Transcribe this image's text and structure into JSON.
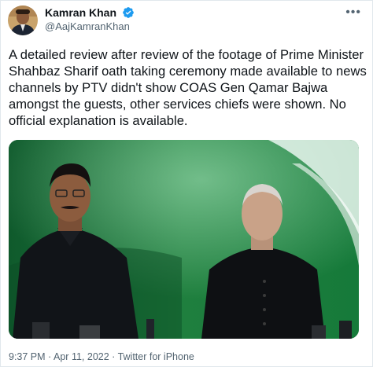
{
  "author": {
    "name": "Kamran Khan",
    "handle": "@AajKamranKhan",
    "verified": true,
    "avatar": "avatar-photo"
  },
  "tweet": {
    "text": "A detailed review after review of the footage of Prime Minister Shahbaz Sharif oath taking ceremony made available to news channels by PTV didn't show COAS Gen Qamar Bajwa amongst the guests, other services chiefs were shown. No official explanation is available.",
    "media": "photo-two-men-at-oath-ceremony"
  },
  "meta": {
    "time": "9:37 PM",
    "separator": "·",
    "date": "Apr 11, 2022",
    "source": "Twitter for iPhone"
  },
  "colors": {
    "verified_blue": "#1d9bf0",
    "secondary_text": "#536471"
  },
  "icons": {
    "more": "more-horizontal-icon",
    "verified": "verified-badge-icon"
  }
}
